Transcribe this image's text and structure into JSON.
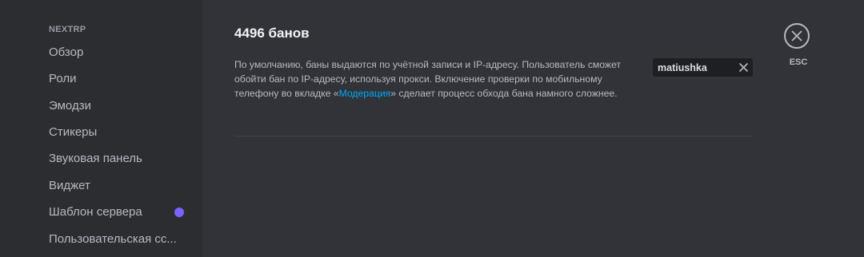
{
  "sidebar": {
    "section_header": "NEXTRP",
    "items": [
      {
        "label": "Обзор"
      },
      {
        "label": "Роли"
      },
      {
        "label": "Эмодзи"
      },
      {
        "label": "Стикеры"
      },
      {
        "label": "Звуковая панель"
      },
      {
        "label": "Виджет"
      },
      {
        "label": "Шаблон сервера",
        "badge_color": "#7b61ff"
      },
      {
        "label": "Пользовательская сс..."
      }
    ]
  },
  "main": {
    "title": "4496 банов",
    "description": {
      "before_link": "По умолчанию, баны выдаются по учётной записи и IP-адресу. Пользователь сможет обойти бан по IP-адресу, используя прокси. Включение проверки по мобильному телефону во вкладке «",
      "link": "Модерация",
      "after_link": "» сделает процесс обхода бана намного сложнее."
    },
    "search": {
      "value": "matiushka",
      "clear_icon": "close-icon"
    }
  },
  "close": {
    "label": "ESC",
    "icon": "close-circle-icon"
  },
  "colors": {
    "background": "#313338",
    "sidebar": "#2b2d31",
    "link": "#00a8fc",
    "badge": "#7b61ff"
  }
}
